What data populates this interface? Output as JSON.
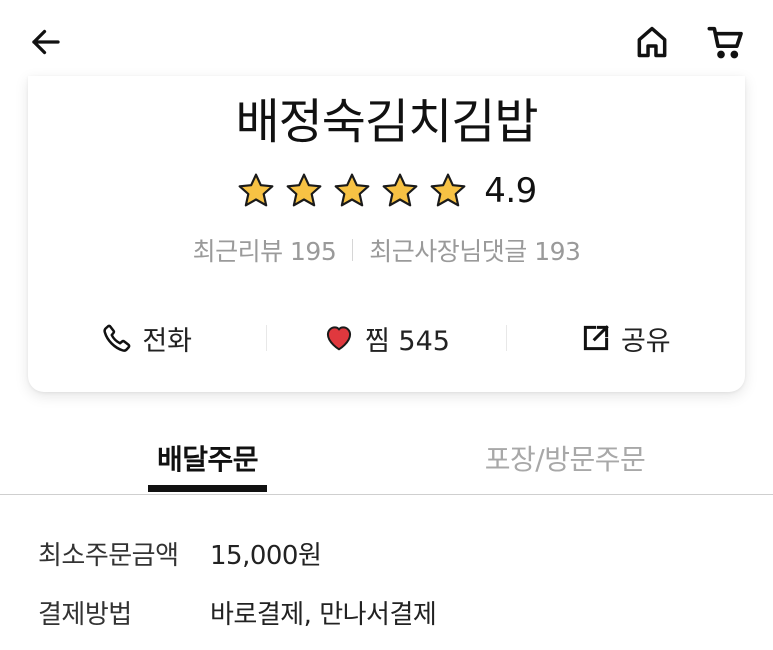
{
  "nav": {
    "back_icon": "arrow-left-icon",
    "home_icon": "home-icon",
    "cart_icon": "cart-icon"
  },
  "store": {
    "name": "배정숙김치김밥",
    "rating": "4.9",
    "star_count": 5,
    "star_color": "#F7C244",
    "recent_reviews": "최근리뷰 195",
    "recent_owner_replies": "최근사장님댓글 193"
  },
  "actions": {
    "call_label": "전화",
    "like_label": "찜 545",
    "share_label": "공유",
    "heart_color": "#E0383E"
  },
  "tabs": {
    "delivery": "배달주문",
    "pickup": "포장/방문주문",
    "active": "delivery"
  },
  "info": {
    "min_order_label": "최소주문금액",
    "min_order_value": "15,000원",
    "payment_label": "결제방법",
    "payment_value": "바로결제, 만나서결제"
  }
}
